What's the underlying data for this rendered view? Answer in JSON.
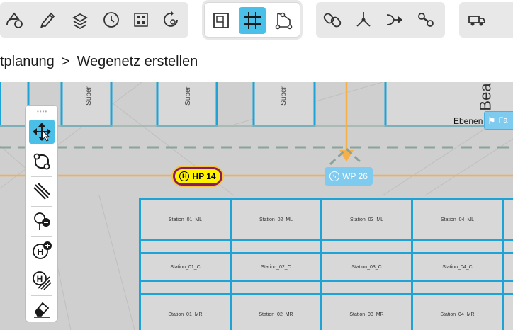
{
  "breadcrumb": {
    "parent": "tplanung",
    "separator": ">",
    "current": "Wegenetz erstellen"
  },
  "toolbar": {
    "group1": [
      "shapes-edit-icon",
      "pencil-icon",
      "layers-icon",
      "clock-icon",
      "grid-dots-icon",
      "rotate-search-icon"
    ],
    "group2": [
      "floor-plan-icon",
      "grid-icon",
      "polygon-nodes-icon"
    ],
    "group2_selected": "grid-icon",
    "group3": [
      "chain-link-icon",
      "branch-icon",
      "merge-arrow-icon",
      "chain-nodes-icon"
    ],
    "group4": [
      "vehicles-icon"
    ]
  },
  "map": {
    "rooms": [
      "Super",
      "Super",
      "Super"
    ],
    "bea_label": "Bea",
    "levels_label": "Ebenen",
    "levels_button": "Fa",
    "hp_marker": {
      "symbol": "H",
      "label": "HP 14"
    },
    "wp_marker": {
      "symbol": "ϟ",
      "label": "WP 26"
    },
    "stations": {
      "row_ml": [
        "Station_01_ML",
        "Station_02_ML",
        "Station_03_ML",
        "Station_04_ML"
      ],
      "row_c": [
        "Station_01_C",
        "Station_02_C",
        "Station_03_C",
        "Station_04_C"
      ],
      "row_mr": [
        "Station_01_MR",
        "Station_02_MR",
        "Station_03_MR",
        "Station_04_MR"
      ]
    }
  },
  "palette": {
    "tools": [
      "move-arrows-icon",
      "node-loop-icon",
      "diagonal-lines-icon",
      "remove-point-icon",
      "add-hold-point-icon",
      "hatched-hold-point-icon",
      "eraser-icon"
    ],
    "selected": "move-arrows-icon"
  },
  "colors": {
    "accent": "#4ac0e8",
    "station_border": "#1ea3d6",
    "path": "#f5b04a",
    "hp_fill": "#fff200",
    "hp_border": "#8b1a66"
  }
}
